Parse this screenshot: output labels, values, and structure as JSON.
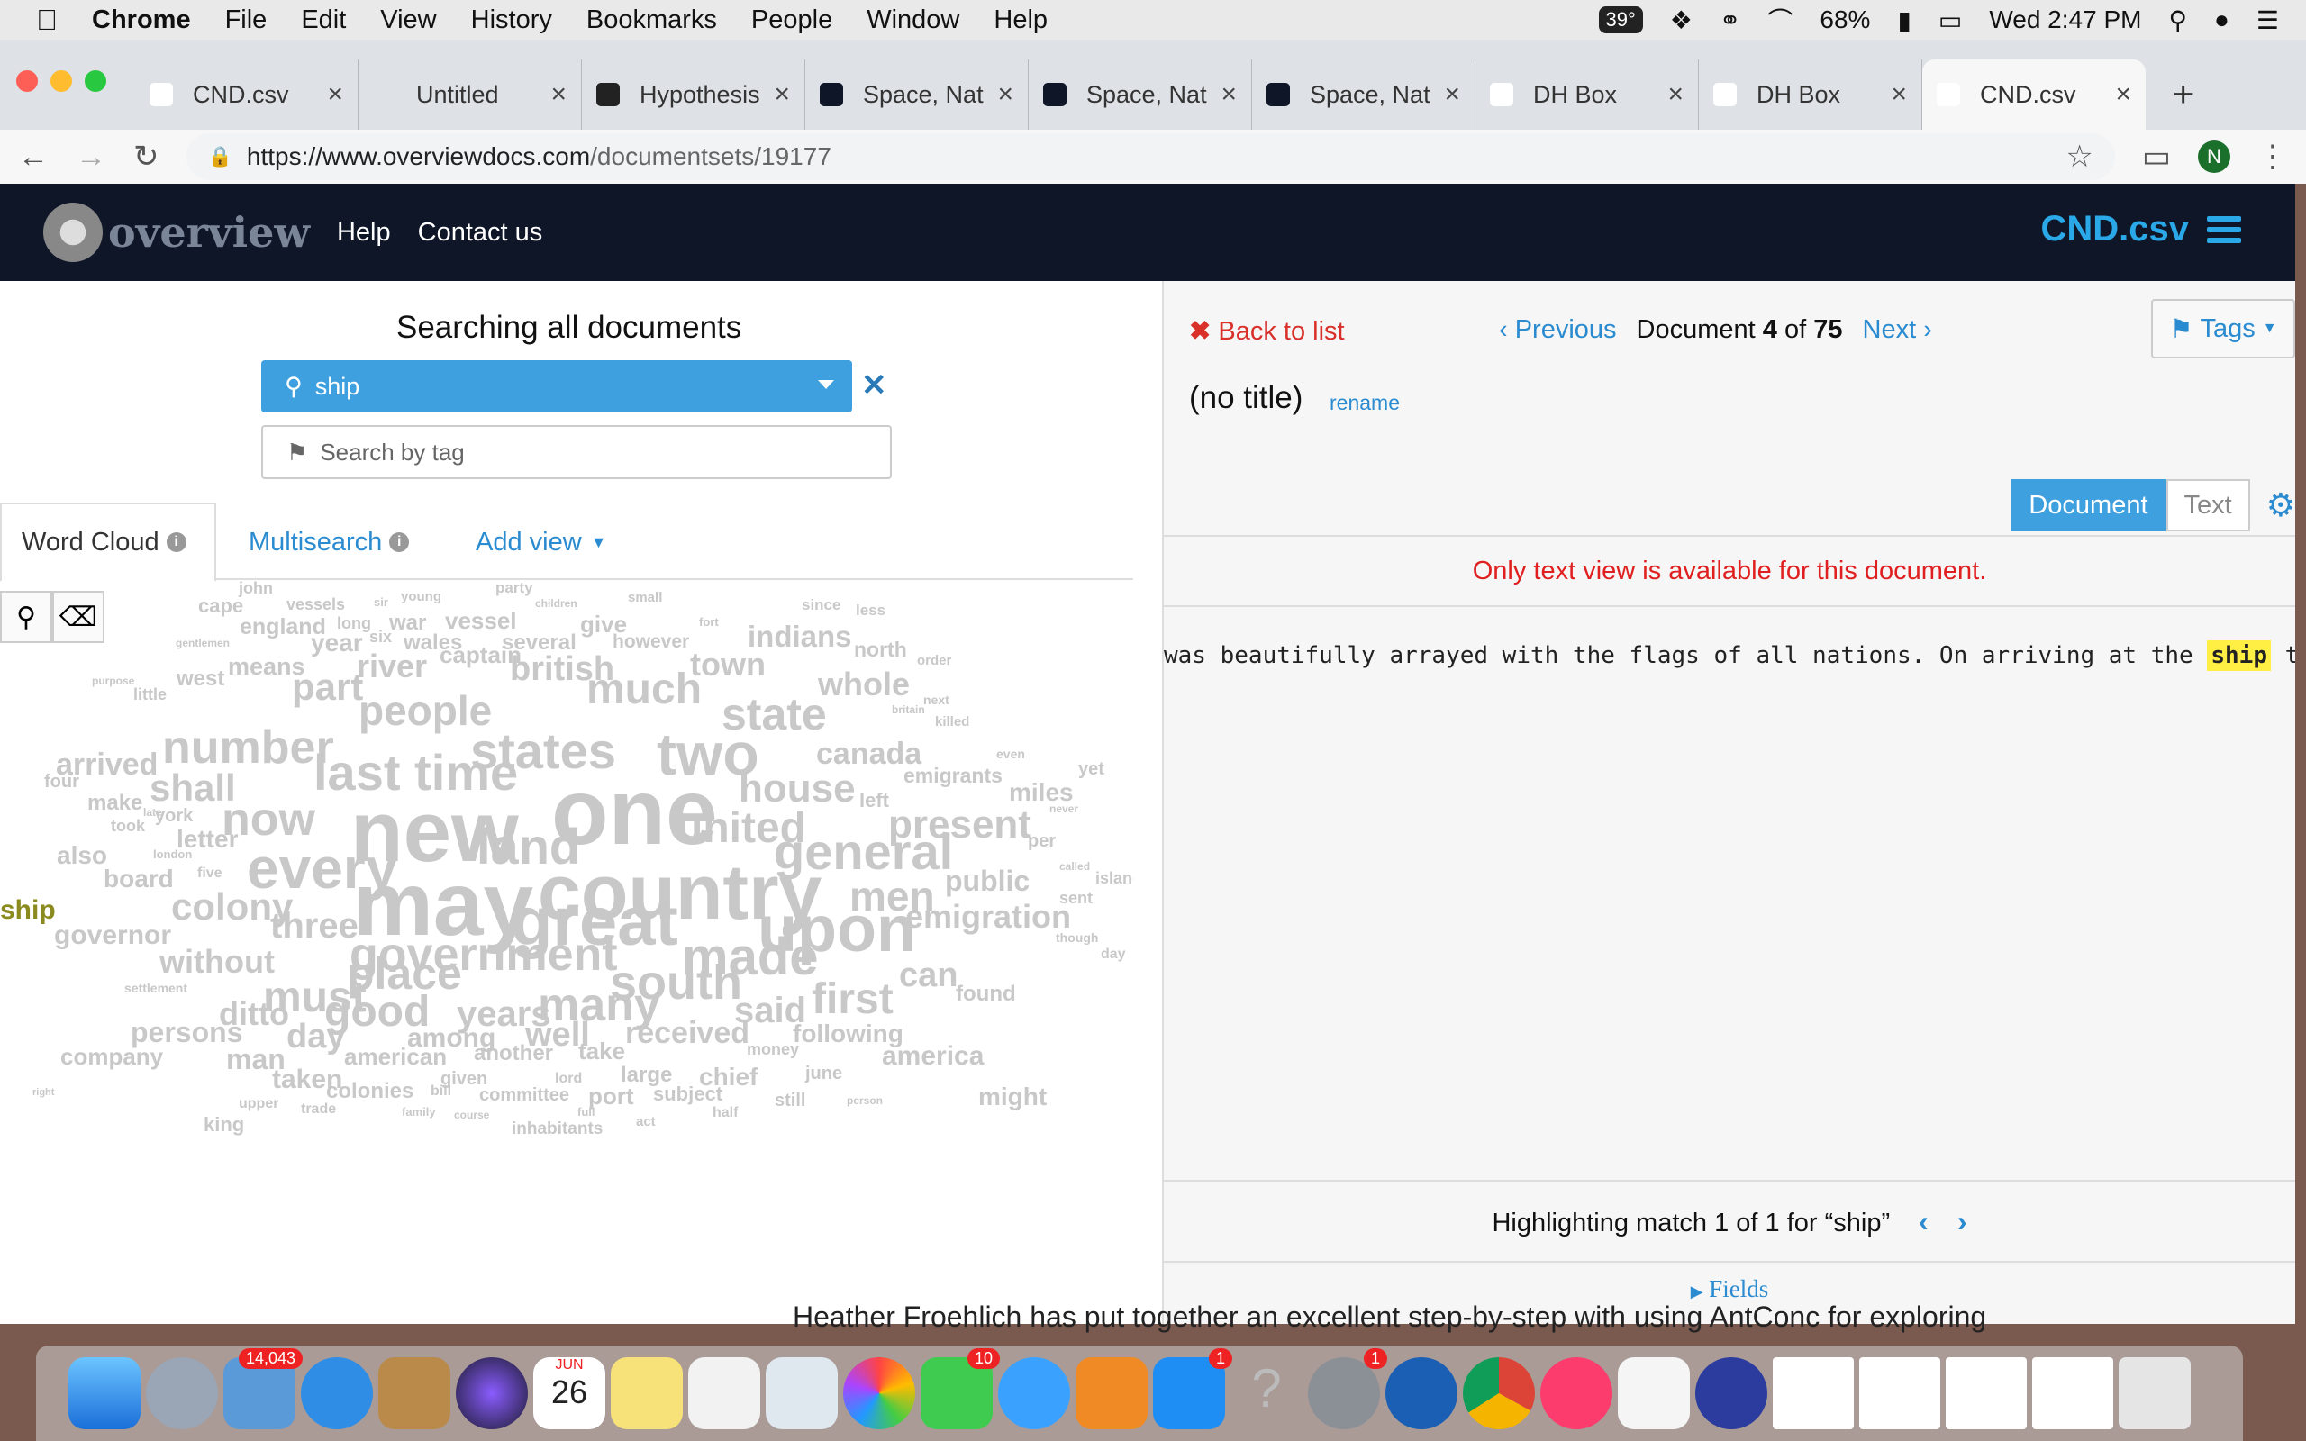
{
  "menubar": {
    "app": "Chrome",
    "items": [
      "File",
      "Edit",
      "View",
      "History",
      "Bookmarks",
      "People",
      "Window",
      "Help"
    ],
    "temp": "39°",
    "battery": "68%",
    "clock": "Wed 2:47 PM"
  },
  "tabs": [
    {
      "title": "CND.csv",
      "icon": "overview-favicon",
      "color": "#ffffff"
    },
    {
      "title": "Untitled",
      "icon": "blank-favicon",
      "color": "#dee1e6"
    },
    {
      "title": "Hypothesis",
      "icon": "hypothesis-favicon",
      "color": "#222222"
    },
    {
      "title": "Space, Nat",
      "icon": "overview-o-favicon",
      "color": "#0e1628"
    },
    {
      "title": "Space, Nat",
      "icon": "overview-o-favicon",
      "color": "#0e1628"
    },
    {
      "title": "Space, Nat",
      "icon": "overview-o-favicon",
      "color": "#0e1628"
    },
    {
      "title": "DH Box",
      "icon": "dhbox-favicon",
      "color": "#ffffff"
    },
    {
      "title": "DH Box",
      "icon": "dhbox-favicon",
      "color": "#ffffff"
    },
    {
      "title": "CND.csv",
      "icon": "overview-favicon",
      "color": "#ffffff"
    }
  ],
  "url": {
    "host": "https://www.overviewdocs.com",
    "path": "/documentsets/19177"
  },
  "profile": "N",
  "header": {
    "logo": "overview",
    "help": "Help",
    "contact": "Contact us",
    "project": "CND.csv"
  },
  "search": {
    "title": "Searching all documents",
    "query": "ship",
    "tag_placeholder": "Search by tag"
  },
  "viewtabs": {
    "wordcloud": "Word Cloud",
    "multisearch": "Multisearch",
    "addview": "Add view"
  },
  "doc": {
    "back": "Back to list",
    "previous": "Previous",
    "doc_label": "Document",
    "doc_num": "4",
    "of": "of",
    "doc_total": "75",
    "next": "Next",
    "tags": "Tags",
    "title": "(no title)",
    "rename": "rename",
    "mode_document": "Document",
    "mode_text": "Text",
    "notice": "Only text view is available for this document.",
    "text_before": "was beautifully arrayed with the flags of all nations. On arriving at the ",
    "text_match": "ship",
    "text_after": " th",
    "highlight": "Highlighting match 1 of 1 for “ship”",
    "fields": "Fields"
  },
  "background_text": "Heather Froehlich has put together an excellent step-by-step with using AntConc for exploring",
  "dock": {
    "mail_badge": "14,043",
    "calendar_month": "JUN",
    "calendar_day": "26",
    "facetime_badge": "10",
    "appstore_badge": "1",
    "prefs_badge": "1"
  },
  "cloud": [
    [
      "john",
      265,
      0,
      18
    ],
    [
      "party",
      550,
      0,
      17
    ],
    [
      "young",
      445,
      11,
      15
    ],
    [
      "cape",
      220,
      18,
      22
    ],
    [
      "vessels",
      318,
      18,
      18
    ],
    [
      "sir",
      415,
      18,
      13
    ],
    [
      "children",
      594,
      20,
      12
    ],
    [
      "small",
      697,
      12,
      15
    ],
    [
      "since",
      890,
      19,
      17
    ],
    [
      "less",
      950,
      25,
      17
    ],
    [
      "england",
      266,
      40,
      25
    ],
    [
      "long",
      374,
      39,
      18
    ],
    [
      "war",
      432,
      36,
      24
    ],
    [
      "vessel",
      494,
      32,
      26
    ],
    [
      "give",
      644,
      36,
      26
    ],
    [
      "fort",
      776,
      40,
      13
    ],
    [
      "indians",
      830,
      46,
      33
    ],
    [
      "gentlemen",
      195,
      64,
      12
    ],
    [
      "year",
      345,
      56,
      28
    ],
    [
      "six",
      410,
      54,
      18
    ],
    [
      "wales",
      448,
      58,
      24
    ],
    [
      "several",
      557,
      58,
      24
    ],
    [
      "however",
      680,
      58,
      21
    ],
    [
      "north",
      948,
      66,
      23
    ],
    [
      "order",
      1018,
      82,
      15
    ],
    [
      "means",
      253,
      83,
      27
    ],
    [
      "river",
      396,
      78,
      36
    ],
    [
      "captain",
      488,
      70,
      26
    ],
    [
      "british",
      566,
      80,
      38
    ],
    [
      "town",
      766,
      76,
      36
    ],
    [
      "purpose",
      102,
      106,
      12
    ],
    [
      "west",
      196,
      98,
      24
    ],
    [
      "part",
      324,
      98,
      42
    ],
    [
      "little",
      148,
      118,
      18
    ],
    [
      "whole",
      908,
      98,
      36
    ],
    [
      "much",
      651,
      98,
      48
    ],
    [
      "people",
      398,
      122,
      46
    ],
    [
      "state",
      801,
      124,
      50
    ],
    [
      "britain",
      990,
      138,
      12
    ],
    [
      "next",
      1025,
      126,
      14
    ],
    [
      "number",
      180,
      160,
      52
    ],
    [
      "states",
      522,
      162,
      56
    ],
    [
      "two",
      729,
      160,
      66
    ],
    [
      "killed",
      1038,
      150,
      15
    ],
    [
      "canada",
      906,
      176,
      34
    ],
    [
      "even",
      1106,
      186,
      14
    ],
    [
      "arrived",
      62,
      188,
      34
    ],
    [
      "last time",
      348,
      186,
      56
    ],
    [
      "yet",
      1197,
      200,
      20
    ],
    [
      "shall",
      166,
      210,
      42
    ],
    [
      "one",
      612,
      206,
      104
    ],
    [
      "house",
      820,
      210,
      44
    ],
    [
      "emigrants",
      1003,
      206,
      23
    ],
    [
      "four",
      49,
      214,
      20
    ],
    [
      "miles",
      1120,
      222,
      28
    ],
    [
      "left",
      954,
      234,
      22
    ],
    [
      "make",
      97,
      236,
      24
    ],
    [
      "never",
      1165,
      248,
      12
    ],
    [
      "took",
      123,
      264,
      18
    ],
    [
      "late",
      159,
      252,
      12
    ],
    [
      "york",
      172,
      252,
      20
    ],
    [
      "new",
      389,
      232,
      96
    ],
    [
      "now",
      246,
      240,
      52
    ],
    [
      "united",
      751,
      252,
      48
    ],
    [
      "present",
      986,
      250,
      44
    ],
    [
      "letter",
      196,
      274,
      28
    ],
    [
      "land",
      529,
      268,
      56
    ],
    [
      "general",
      859,
      274,
      56
    ],
    [
      "per",
      1141,
      280,
      20
    ],
    [
      "also",
      63,
      292,
      28
    ],
    [
      "london",
      170,
      298,
      13
    ],
    [
      "every",
      274,
      288,
      64
    ],
    [
      "five",
      219,
      318,
      16
    ],
    [
      "called",
      1176,
      312,
      12
    ],
    [
      "island",
      1216,
      322,
      18
    ],
    [
      "board",
      115,
      318,
      28
    ],
    [
      "may",
      392,
      310,
      100
    ],
    [
      "country",
      597,
      304,
      86
    ],
    [
      "men",
      943,
      328,
      46
    ],
    [
      "public",
      1049,
      318,
      32
    ],
    [
      "sent",
      1176,
      344,
      18
    ],
    [
      "ship",
      0,
      352,
      30
    ],
    [
      "colony",
      190,
      342,
      42
    ],
    [
      "great",
      567,
      342,
      76
    ],
    [
      "upon",
      841,
      352,
      72
    ],
    [
      "emigration",
      1005,
      356,
      36
    ],
    [
      "governor",
      60,
      380,
      30
    ],
    [
      "three",
      300,
      364,
      40
    ],
    [
      "though",
      1172,
      390,
      14
    ],
    [
      "without",
      177,
      406,
      36
    ],
    [
      "government",
      388,
      390,
      52
    ],
    [
      "made",
      757,
      390,
      58
    ],
    [
      "day",
      1222,
      408,
      16
    ],
    [
      "place",
      385,
      412,
      50
    ],
    [
      "south",
      677,
      420,
      54
    ],
    [
      "can",
      998,
      420,
      38
    ],
    [
      "settlement",
      138,
      446,
      14
    ],
    [
      "must",
      292,
      440,
      48
    ],
    [
      "first",
      901,
      442,
      48
    ],
    [
      "found",
      1061,
      448,
      24
    ],
    [
      "ditto",
      243,
      464,
      36
    ],
    [
      "good",
      360,
      456,
      48
    ],
    [
      "years",
      507,
      462,
      40
    ],
    [
      "many",
      597,
      446,
      52
    ],
    [
      "said",
      815,
      458,
      40
    ],
    [
      "persons",
      145,
      486,
      32
    ],
    [
      "day",
      318,
      488,
      38
    ],
    [
      "among",
      452,
      494,
      30
    ],
    [
      "well",
      583,
      486,
      38
    ],
    [
      "received",
      694,
      486,
      34
    ],
    [
      "following",
      880,
      490,
      28
    ],
    [
      "company",
      67,
      516,
      26
    ],
    [
      "man",
      251,
      516,
      32
    ],
    [
      "american",
      382,
      516,
      26
    ],
    [
      "another",
      526,
      514,
      24
    ],
    [
      "take",
      642,
      510,
      26
    ],
    [
      "money",
      829,
      512,
      18
    ],
    [
      "america",
      979,
      514,
      30
    ],
    [
      "taken",
      302,
      540,
      30
    ],
    [
      "given",
      489,
      544,
      20
    ],
    [
      "lord",
      616,
      546,
      16
    ],
    [
      "large",
      689,
      538,
      24
    ],
    [
      "chief",
      776,
      538,
      28
    ],
    [
      "june",
      894,
      538,
      20
    ],
    [
      "colonies",
      362,
      556,
      24
    ],
    [
      "bill",
      478,
      560,
      16
    ],
    [
      "committee",
      532,
      562,
      20
    ],
    [
      "port",
      653,
      560,
      26
    ],
    [
      "subject",
      725,
      560,
      22
    ],
    [
      "person",
      940,
      572,
      12
    ],
    [
      "still",
      860,
      568,
      20
    ],
    [
      "might",
      1086,
      560,
      28
    ],
    [
      "right",
      36,
      564,
      11
    ],
    [
      "upper",
      265,
      574,
      16
    ],
    [
      "trade",
      334,
      580,
      16
    ],
    [
      "family",
      446,
      584,
      13
    ],
    [
      "course",
      504,
      588,
      12
    ],
    [
      "full",
      641,
      584,
      13
    ],
    [
      "act",
      706,
      594,
      15
    ],
    [
      "half",
      791,
      584,
      16
    ],
    [
      "king",
      226,
      594,
      22
    ],
    [
      "inhabitants",
      568,
      600,
      19
    ]
  ]
}
